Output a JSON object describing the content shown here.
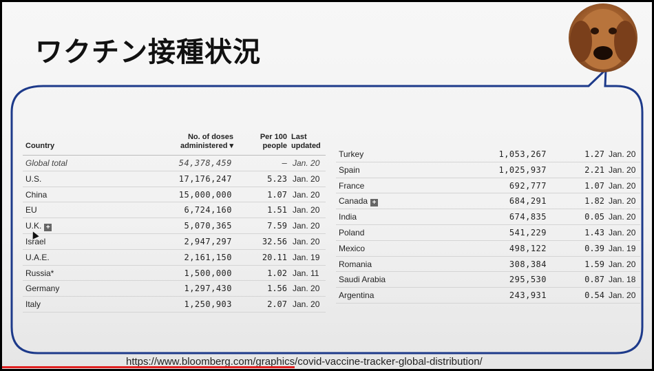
{
  "slide": {
    "title": "ワクチン接種状況",
    "url": "https://www.bloomberg.com/graphics/covid-vaccine-tracker-global-distribution/",
    "progress_fraction": 0.45
  },
  "table": {
    "headers": {
      "country": "Country",
      "doses_line1": "No. of doses",
      "doses_line2": "administered ▾",
      "per_line1": "Per 100",
      "per_line2": "people",
      "last_line1": "Last",
      "last_line2": "updated"
    },
    "left_rows": [
      {
        "country": "Global total",
        "doses": "54,378,459",
        "per100": "–",
        "updated": "Jan. 20"
      },
      {
        "country": "U.S.",
        "doses": "17,176,247",
        "per100": "5.23",
        "updated": "Jan. 20"
      },
      {
        "country": "China",
        "doses": "15,000,000",
        "per100": "1.07",
        "updated": "Jan. 20"
      },
      {
        "country": "EU",
        "doses": "6,724,160",
        "per100": "1.51",
        "updated": "Jan. 20"
      },
      {
        "country": "U.K.",
        "doses": "5,070,365",
        "per100": "7.59",
        "updated": "Jan. 20"
      },
      {
        "country": "Israel",
        "doses": "2,947,297",
        "per100": "32.56",
        "updated": "Jan. 20"
      },
      {
        "country": "U.A.E.",
        "doses": "2,161,150",
        "per100": "20.11",
        "updated": "Jan. 19"
      },
      {
        "country": "Russia*",
        "doses": "1,500,000",
        "per100": "1.02",
        "updated": "Jan. 11"
      },
      {
        "country": "Germany",
        "doses": "1,297,430",
        "per100": "1.56",
        "updated": "Jan. 20"
      },
      {
        "country": "Italy",
        "doses": "1,250,903",
        "per100": "2.07",
        "updated": "Jan. 20"
      }
    ],
    "right_rows": [
      {
        "country": "Turkey",
        "doses": "1,053,267",
        "per100": "1.27",
        "updated": "Jan. 20"
      },
      {
        "country": "Spain",
        "doses": "1,025,937",
        "per100": "2.21",
        "updated": "Jan. 20"
      },
      {
        "country": "France",
        "doses": "692,777",
        "per100": "1.07",
        "updated": "Jan. 20"
      },
      {
        "country": "Canada",
        "doses": "684,291",
        "per100": "1.82",
        "updated": "Jan. 20"
      },
      {
        "country": "India",
        "doses": "674,835",
        "per100": "0.05",
        "updated": "Jan. 20"
      },
      {
        "country": "Poland",
        "doses": "541,229",
        "per100": "1.43",
        "updated": "Jan. 20"
      },
      {
        "country": "Mexico",
        "doses": "498,122",
        "per100": "0.39",
        "updated": "Jan. 19"
      },
      {
        "country": "Romania",
        "doses": "308,384",
        "per100": "1.59",
        "updated": "Jan. 20"
      },
      {
        "country": "Saudi Arabia",
        "doses": "295,530",
        "per100": "0.87",
        "updated": "Jan. 18"
      },
      {
        "country": "Argentina",
        "doses": "243,931",
        "per100": "0.54",
        "updated": "Jan. 20"
      }
    ]
  },
  "icons": {
    "avatar": "dog-avatar-icon",
    "expand": "plus-icon"
  },
  "colors": {
    "bubble_border": "#1d3a8a",
    "progress": "#e02020"
  }
}
